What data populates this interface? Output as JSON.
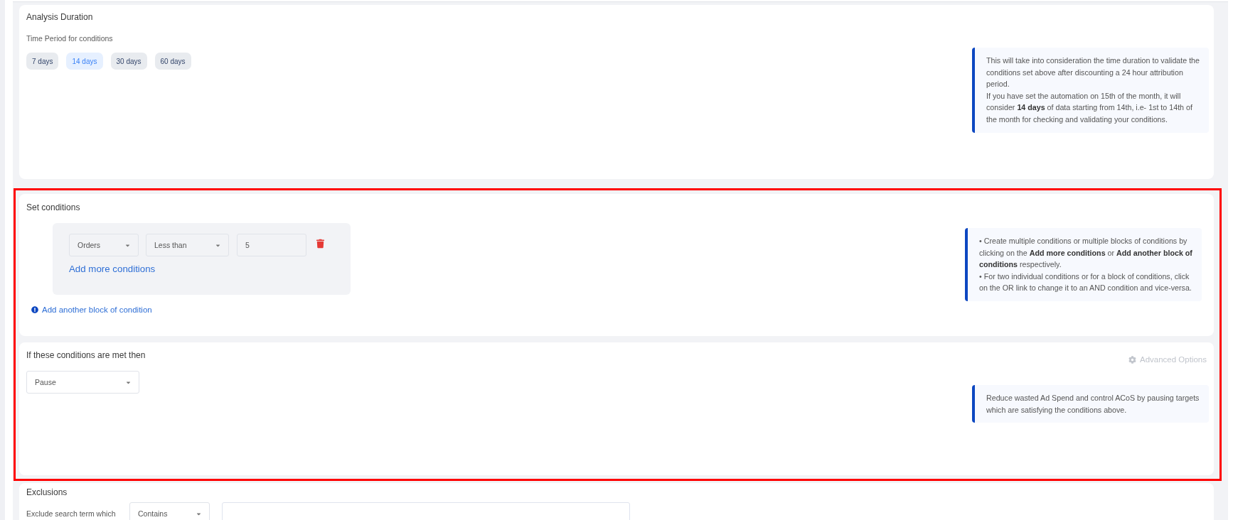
{
  "analysis_duration": {
    "title": "Analysis Duration",
    "label": "Time Period for conditions",
    "options": [
      {
        "label": "7 days",
        "selected": false
      },
      {
        "label": "14 days",
        "selected": true
      },
      {
        "label": "30 days",
        "selected": false
      },
      {
        "label": "60 days",
        "selected": false
      }
    ],
    "info": [
      "This will take into consideration the time duration to validate the conditions set above after discounting a 24 hour attribution period.",
      "If you have set the automation on 15th of the month, it will consider **14 days** of data starting from 14th, i.e- 1st to 14th of the month for checking and validating your conditions."
    ]
  },
  "set_conditions": {
    "title": "Set conditions",
    "conditions": [
      {
        "metric": "Orders",
        "operator": "Less than",
        "value": "5"
      }
    ],
    "add_condition": "Add more conditions",
    "add_block": "Add another block of condition",
    "info": [
      "• Create multiple conditions or multiple blocks of conditions by clicking on the **Add more conditions** or **Add another block of conditions** respectively.",
      "• For two individual conditions or for a block of conditions, click on the OR link to change it to an AND condition and vice-versa."
    ]
  },
  "action": {
    "title": "If these conditions are met then",
    "advanced_options": {
      "label": "Advanced Options",
      "disabled": true
    },
    "dropdown": "Pause",
    "info": [
      "Reduce wasted Ad Spend and control ACoS by pausing targets which are satisfying the conditions above."
    ]
  },
  "exclusions": {
    "title": "Exclusions",
    "label": "Exclude search term which",
    "match": "Contains"
  }
}
